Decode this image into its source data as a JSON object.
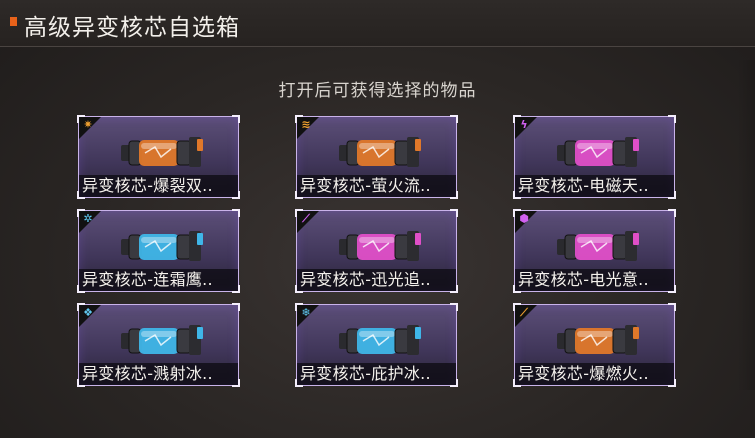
{
  "window": {
    "title": "高级异变核芯自选箱"
  },
  "subtitle": "打开后可获得选择的物品",
  "colors": {
    "accent": "#e8621a",
    "card_border": "#c9b3ea",
    "orange_core": "#e0782a",
    "blue_core": "#3fb6e8",
    "pink_core": "#e04fc8"
  },
  "items": [
    {
      "label": "异变核芯-爆裂双..",
      "badge_icon": "burst-icon",
      "core_color": "#e0782a",
      "icon_color": "#f0a030"
    },
    {
      "label": "异变核芯-萤火流..",
      "badge_icon": "flame-streak-icon",
      "core_color": "#e0782a",
      "icon_color": "#f0a030"
    },
    {
      "label": "异变核芯-电磁天..",
      "badge_icon": "lightning-icon",
      "core_color": "#e04fc8",
      "icon_color": "#d060f0"
    },
    {
      "label": "异变核芯-连霜鹰..",
      "badge_icon": "frost-icon",
      "core_color": "#3fb6e8",
      "icon_color": "#60c8f0"
    },
    {
      "label": "异变核芯-迅光追..",
      "badge_icon": "beam-icon",
      "core_color": "#e04fc8",
      "icon_color": "#d060f0"
    },
    {
      "label": "异变核芯-电光意..",
      "badge_icon": "shield-orb-icon",
      "core_color": "#e04fc8",
      "icon_color": "#d060f0"
    },
    {
      "label": "异变核芯-溅射冰..",
      "badge_icon": "ice-shard-icon",
      "core_color": "#3fb6e8",
      "icon_color": "#60c8f0"
    },
    {
      "label": "异变核芯-庇护冰..",
      "badge_icon": "snowflake-icon",
      "core_color": "#3fb6e8",
      "icon_color": "#60c8f0"
    },
    {
      "label": "异变核芯-爆燃火..",
      "badge_icon": "fire-bolt-icon",
      "core_color": "#e0782a",
      "icon_color": "#f0a030"
    }
  ]
}
